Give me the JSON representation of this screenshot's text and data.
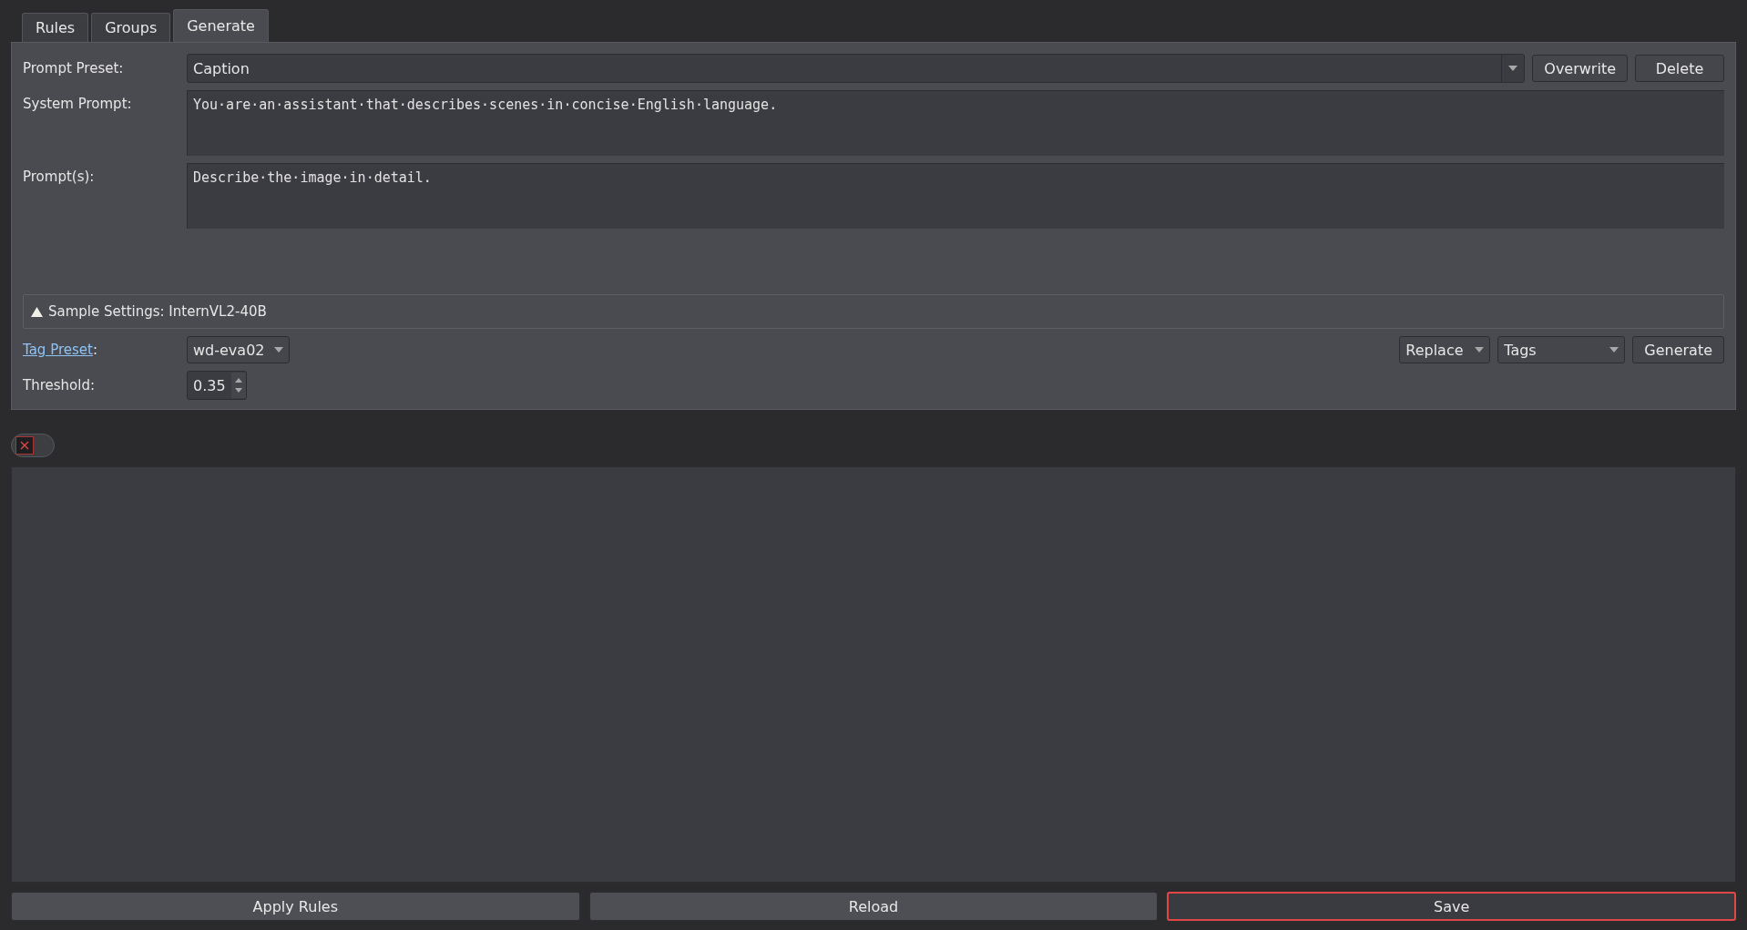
{
  "tabs": [
    {
      "label": "Rules",
      "selected": false
    },
    {
      "label": "Groups",
      "selected": false
    },
    {
      "label": "Generate",
      "selected": true
    }
  ],
  "prompt_preset": {
    "label": "Prompt Preset:",
    "value": "Caption",
    "buttons": [
      "Overwrite",
      "Delete"
    ]
  },
  "system_prompt": {
    "label": "System Prompt:",
    "value": "You·are·an·assistant·that·describes·scenes·in·concise·English·language."
  },
  "prompts": {
    "label": "Prompt(s):",
    "value": "Describe·the·image·in·detail."
  },
  "sample_settings": {
    "label": "Sample Settings: InternVL2-40B",
    "expanded": false
  },
  "tag_preset": {
    "link": "Tag Preset",
    "suffix": ":",
    "value": "wd-eva02",
    "mode": "Replace",
    "target": "Tags",
    "button": "Generate"
  },
  "threshold": {
    "label": "Threshold:",
    "value": "0.35"
  },
  "toggle": {
    "on": false
  },
  "bottom_buttons": [
    {
      "label": "Apply Rules",
      "highlighted": false
    },
    {
      "label": "Reload",
      "highlighted": false
    },
    {
      "label": "Save",
      "highlighted": true
    }
  ]
}
